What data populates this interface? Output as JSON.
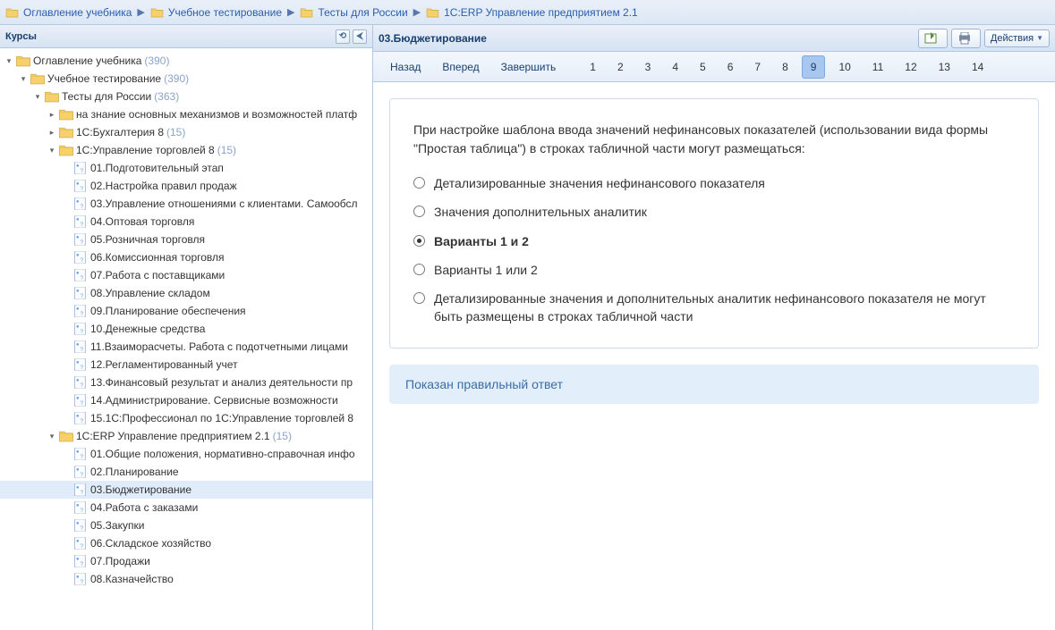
{
  "breadcrumb": [
    {
      "label": "Оглавление учебника",
      "icon": "folder"
    },
    {
      "label": "Учебное тестирование",
      "icon": "folder"
    },
    {
      "label": "Тесты для России",
      "icon": "folder"
    },
    {
      "label": "1С:ERP Управление предприятием 2.1",
      "icon": "folder"
    }
  ],
  "left_panel": {
    "title": "Курсы"
  },
  "tree": [
    {
      "indent": 0,
      "exp": "open",
      "icon": "folder",
      "label": "Оглавление учебника",
      "count": "(390)"
    },
    {
      "indent": 1,
      "exp": "open",
      "icon": "folder",
      "label": "Учебное тестирование",
      "count": "(390)"
    },
    {
      "indent": 2,
      "exp": "open",
      "icon": "folder",
      "label": "Тесты для России",
      "count": "(363)"
    },
    {
      "indent": 3,
      "exp": "closed",
      "icon": "folder",
      "label": "на знание основных механизмов и возможностей платф"
    },
    {
      "indent": 3,
      "exp": "closed",
      "icon": "folder",
      "label": "1С:Бухгалтерия 8",
      "count": "(15)"
    },
    {
      "indent": 3,
      "exp": "open",
      "icon": "folder",
      "label": "1С:Управление торговлей 8",
      "count": "(15)"
    },
    {
      "indent": 4,
      "exp": "none",
      "icon": "doc",
      "label": "01.Подготовительный этап"
    },
    {
      "indent": 4,
      "exp": "none",
      "icon": "doc",
      "label": "02.Настройка правил продаж"
    },
    {
      "indent": 4,
      "exp": "none",
      "icon": "doc",
      "label": "03.Управление отношениями с клиентами. Самообсл"
    },
    {
      "indent": 4,
      "exp": "none",
      "icon": "doc",
      "label": "04.Оптовая торговля"
    },
    {
      "indent": 4,
      "exp": "none",
      "icon": "doc",
      "label": "05.Розничная торговля"
    },
    {
      "indent": 4,
      "exp": "none",
      "icon": "doc",
      "label": "06.Комиссионная торговля"
    },
    {
      "indent": 4,
      "exp": "none",
      "icon": "doc",
      "label": "07.Работа с поставщиками"
    },
    {
      "indent": 4,
      "exp": "none",
      "icon": "doc",
      "label": "08.Управление складом"
    },
    {
      "indent": 4,
      "exp": "none",
      "icon": "doc",
      "label": "09.Планирование обеспечения"
    },
    {
      "indent": 4,
      "exp": "none",
      "icon": "doc",
      "label": "10.Денежные средства"
    },
    {
      "indent": 4,
      "exp": "none",
      "icon": "doc",
      "label": "11.Взаиморасчеты. Работа с подотчетными лицами"
    },
    {
      "indent": 4,
      "exp": "none",
      "icon": "doc",
      "label": "12.Регламентированный учет"
    },
    {
      "indent": 4,
      "exp": "none",
      "icon": "doc",
      "label": "13.Финансовый результат и анализ деятельности пр"
    },
    {
      "indent": 4,
      "exp": "none",
      "icon": "doc",
      "label": "14.Администрирование. Сервисные возможности"
    },
    {
      "indent": 4,
      "exp": "none",
      "icon": "doc",
      "label": "15.1С:Профессионал по 1С:Управление торговлей 8"
    },
    {
      "indent": 3,
      "exp": "open",
      "icon": "folder",
      "label": "1С:ERP Управление предприятием 2.1",
      "count": "(15)"
    },
    {
      "indent": 4,
      "exp": "none",
      "icon": "doc",
      "label": "01.Общие положения, нормативно-справочная инфо"
    },
    {
      "indent": 4,
      "exp": "none",
      "icon": "doc",
      "label": "02.Планирование"
    },
    {
      "indent": 4,
      "exp": "none",
      "icon": "doc",
      "label": "03.Бюджетирование",
      "selected": true
    },
    {
      "indent": 4,
      "exp": "none",
      "icon": "doc",
      "label": "04.Работа с заказами"
    },
    {
      "indent": 4,
      "exp": "none",
      "icon": "doc",
      "label": "05.Закупки"
    },
    {
      "indent": 4,
      "exp": "none",
      "icon": "doc",
      "label": "06.Складское хозяйство"
    },
    {
      "indent": 4,
      "exp": "none",
      "icon": "doc",
      "label": "07.Продажи"
    },
    {
      "indent": 4,
      "exp": "none",
      "icon": "doc",
      "label": "08.Казначейство"
    }
  ],
  "right": {
    "title": "03.Бюджетирование",
    "actions_label": "Действия"
  },
  "pager": {
    "back": "Назад",
    "forward": "Вперед",
    "finish": "Завершить",
    "pages": [
      "1",
      "2",
      "3",
      "4",
      "5",
      "6",
      "7",
      "8",
      "9",
      "10",
      "11",
      "12",
      "13",
      "14"
    ],
    "active": "9"
  },
  "question": "При настройке шаблона ввода значений нефинансовых показателей (использовании вида формы \"Простая таблица\") в строках табличной части могут размещаться:",
  "answers": [
    {
      "text": "Детализированные значения нефинансового показателя",
      "correct": false
    },
    {
      "text": "Значения дополнительных аналитик",
      "correct": false
    },
    {
      "text": "Варианты 1 и 2",
      "correct": true
    },
    {
      "text": "Варианты 1 или 2",
      "correct": false
    },
    {
      "text": "Детализированные значения и дополнительных аналитик нефинансового показателя не могут быть размещены в строках табличной части",
      "correct": false
    }
  ],
  "info": "Показан правильный ответ"
}
